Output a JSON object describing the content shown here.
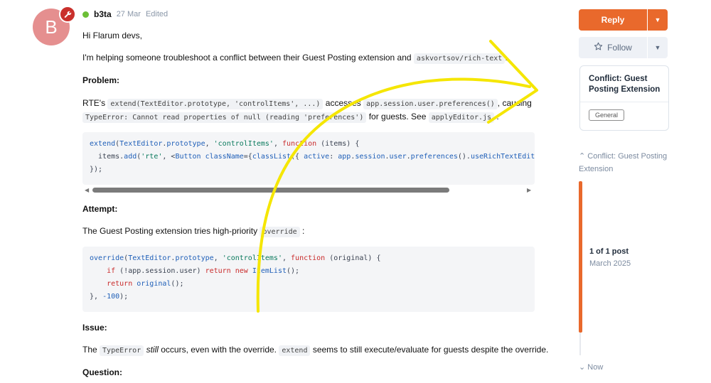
{
  "post": {
    "avatar_letter": "B",
    "username": "b3ta",
    "date": "27 Mar",
    "edited": "Edited",
    "greeting": "Hi Flarum devs,",
    "intro": {
      "text": "I'm helping someone troubleshoot a conflict between their Guest Posting extension and",
      "code": "askvortsov/rich-text",
      "end": "."
    },
    "problem_heading": "Problem:",
    "problem": {
      "pre": "RTE's",
      "code1": "extend(TextEditor.prototype, 'controlItems', ...)",
      "mid": "accesses",
      "code2": "app.session.user.preferences()",
      "post": ", causing",
      "code3": "TypeError: Cannot read properties of null (reading 'preferences')",
      "mid2": "for guests. See",
      "code4": "applyEditor.js",
      "end": ":"
    },
    "code_block_1": [
      "extend(TextEditor.prototype, 'controlItems', function (items) {",
      "  items.add('rte', <Button className={classList({ active: app.session.user.preferences().useRichTextEditor }",
      "});"
    ],
    "attempt_heading": "Attempt:",
    "attempt": {
      "text": "The Guest Posting extension tries high-priority",
      "code": "override",
      "end": ":"
    },
    "code_block_2": [
      "override(TextEditor.prototype, 'controlItems', function (original) {",
      "    if (!app.session.user) return new ItemList();",
      "    return original();",
      "}, -100);"
    ],
    "issue_heading": "Issue:",
    "issue": {
      "pre": "The",
      "code1": "TypeError",
      "em": "still",
      "mid": "occurs, even with the override.",
      "code2": "extend",
      "post": "seems to still execute/evaluate for guests despite the override."
    },
    "question_heading": "Question:"
  },
  "sidebar": {
    "reply_label": "Reply",
    "follow_label": "Follow",
    "card_title": "Conflict: Guest Posting Extension",
    "tag_label": "General",
    "scrub_title": "Conflict: Guest Posting Extension",
    "scrub_count": "1 of 1 post",
    "scrub_date": "March 2025",
    "scrub_now": "Now"
  },
  "colors": {
    "accent": "#e9692c",
    "online": "#6cbf36",
    "avatar": "#e58f8f",
    "badge": "#c9302c",
    "annotation": "#f5e600"
  },
  "icons": [
    "wrench-icon",
    "star-icon",
    "caret-down-icon",
    "chevron-up-icon",
    "chevron-down-icon"
  ]
}
